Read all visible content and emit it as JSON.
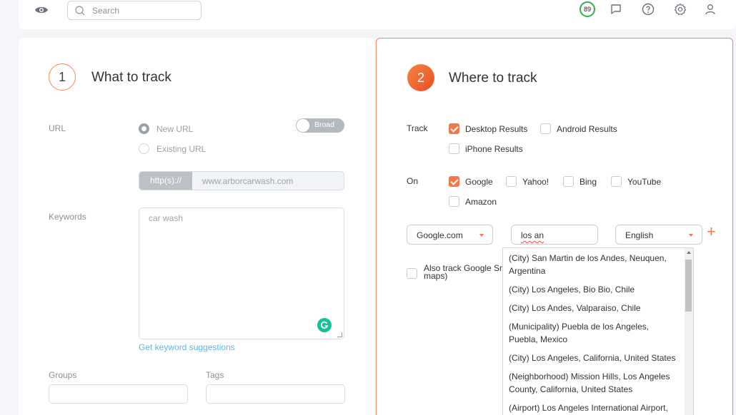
{
  "topbar": {
    "search_placeholder": "Search",
    "score": "89"
  },
  "left_panel": {
    "step_number": "1",
    "title": "What to track",
    "url_label": "URL",
    "url_options": [
      "New URL",
      "Existing URL"
    ],
    "selected_url_option": "New URL",
    "broad_toggle": "Broad",
    "url_prefix": "http(s)://",
    "url_value": "www.arborcarwash.com",
    "keywords_label": "Keywords",
    "keywords_value": "car wash",
    "keyword_suggestions_link": "Get keyword suggestions",
    "groups_label": "Groups",
    "tags_label": "Tags"
  },
  "right_panel": {
    "step_number": "2",
    "title": "Where to track",
    "track_label": "Track",
    "track_options": [
      {
        "label": "Desktop Results",
        "checked": true
      },
      {
        "label": "Android Results",
        "checked": false
      },
      {
        "label": "iPhone Results",
        "checked": false
      }
    ],
    "on_label": "On",
    "on_options": [
      {
        "label": "Google",
        "checked": true
      },
      {
        "label": "Yahoo!",
        "checked": false
      },
      {
        "label": "Bing",
        "checked": false
      },
      {
        "label": "YouTube",
        "checked": false
      },
      {
        "label": "Amazon",
        "checked": false
      }
    ],
    "search_engine_select": "Google.com",
    "location_input": "los an",
    "language_select": "English",
    "also_track_text": "Also track Google Sn maps)"
  },
  "location_dropdown": {
    "items": [
      "(City) San Martin de los Andes, Neuquen, Argentina",
      "(City) Los Angeles, Bio Bio, Chile",
      "(City) Los Andes, Valparaiso, Chile",
      "(Municipality) Puebla de los Angeles, Puebla, Mexico",
      "(City) Los Angeles, California, United States",
      "(Neighborhood) Mission Hills, Los Angeles County, California, United States",
      "(Airport) Los Angeles International Airport,"
    ]
  },
  "colors": {
    "accent": "#f2784b",
    "score_ring": "#2bb24c",
    "link": "#5fb4e6"
  }
}
